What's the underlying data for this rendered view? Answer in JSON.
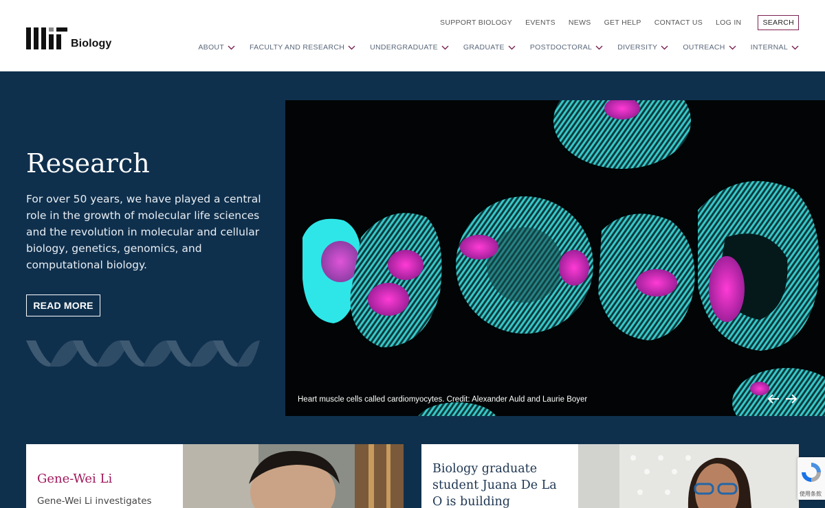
{
  "logo": {
    "text": "Biology"
  },
  "utility_nav": [
    "SUPPORT BIOLOGY",
    "EVENTS",
    "NEWS",
    "GET HELP",
    "CONTACT US",
    "LOG IN"
  ],
  "search_label": "SEARCH",
  "main_nav": [
    "ABOUT",
    "FACULTY AND RESEARCH",
    "UNDERGRADUATE",
    "GRADUATE",
    "POSTDOCTORAL",
    "DIVERSITY",
    "OUTREACH",
    "INTERNAL"
  ],
  "hero": {
    "title": "Research",
    "description": "For over 50 years, we have played a central role in the growth of molecular life sciences and the revolution in molecular and cellular biology, genetics, genomics, and computational biology.",
    "button": "READ MORE",
    "caption": "Heart muscle cells called cardiomyocytes. Credit: Alexander Auld and Laurie Boyer"
  },
  "cards": [
    {
      "title": "Gene-Wei Li",
      "subtitle": "Gene-Wei Li investigates"
    },
    {
      "title": "Biology graduate student Juana De La O is building connections"
    }
  ],
  "recaptcha": {
    "terms": "使用条款"
  },
  "colors": {
    "navy": "#0f304d",
    "accent": "#a0185c",
    "nav_text": "#596779"
  }
}
